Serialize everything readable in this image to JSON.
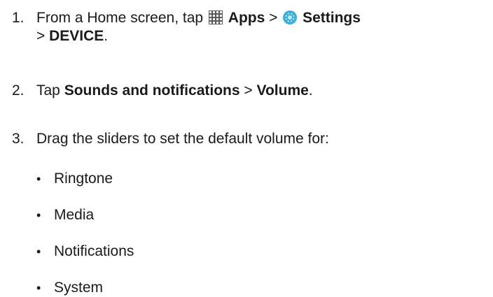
{
  "steps": [
    {
      "num": "1.",
      "pre": "From a Home screen, tap",
      "apps_label": "Apps",
      "sep1": ">",
      "settings_label": "Settings",
      "sep2": ">",
      "device_label": "DEVICE",
      "end": ".",
      "icons": [
        "apps-grid-icon",
        "settings-gear-icon"
      ]
    },
    {
      "num": "2.",
      "pre": "Tap",
      "sounds_label": "Sounds and notifications",
      "sep": ">",
      "volume_label": "Volume",
      "end": "."
    },
    {
      "num": "3.",
      "text": "Drag the sliders to set the default volume for:"
    }
  ],
  "bullets": [
    "Ringtone",
    "Media",
    "Notifications",
    "System"
  ],
  "bullet_char": "•",
  "colors": {
    "text": "#1a1a1a",
    "apps_icon": "#5a5a5a",
    "settings_icon_outer": "#3ab0d8",
    "settings_icon_inner": "#bfe8f5"
  }
}
